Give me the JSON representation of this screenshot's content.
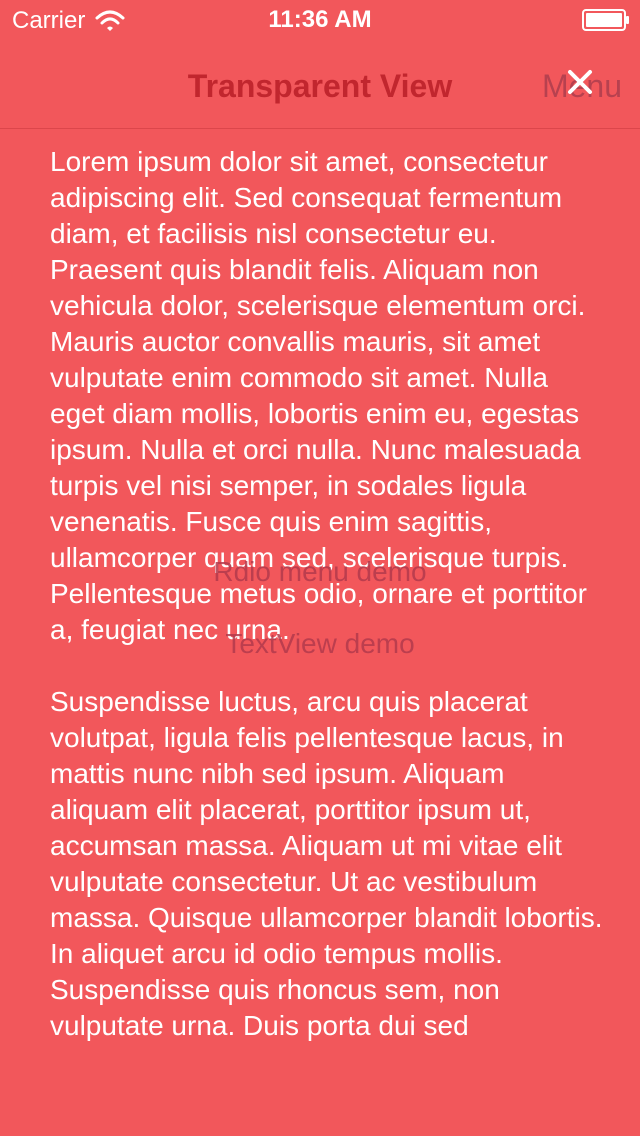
{
  "status_bar": {
    "carrier": "Carrier",
    "time": "11:36 AM",
    "wifi_icon": "wifi-icon",
    "battery_icon": "battery-icon"
  },
  "nav": {
    "title": "Transparent View",
    "menu_label": "Menu",
    "close_icon": "close-icon"
  },
  "content": {
    "paragraph_1": "Lorem ipsum dolor sit amet, consectetur adipiscing elit. Sed consequat fermentum diam, et facilisis nisl consectetur eu. Praesent quis blandit felis. Aliquam non vehicula dolor, scelerisque elementum orci. Mauris auctor convallis mauris, sit amet vulputate enim commodo sit amet. Nulla eget diam mollis, lobortis enim eu, egestas ipsum. Nulla et orci nulla. Nunc malesuada turpis vel nisi semper, in sodales ligula venenatis. Fusce quis enim sagittis, ullamcorper quam sed, scelerisque turpis. Pellentesque metus odio, ornare et porttitor a, feugiat nec urna.",
    "paragraph_2": "Suspendisse luctus, arcu quis placerat volutpat, ligula felis pellentesque lacus, in mattis nunc nibh sed ipsum. Aliquam aliquam elit placerat, porttitor ipsum ut, accumsan massa. Aliquam ut mi vitae elit vulputate consectetur. Ut ac vestibulum massa. Quisque ullamcorper blandit lobortis. In aliquet arcu id odio tempus mollis. Suspendisse quis rhoncus sem, non vulputate urna. Duis porta dui sed"
  },
  "menu": {
    "items": [
      {
        "label": "Rdio menu demo"
      },
      {
        "label": "TextView demo"
      }
    ]
  },
  "colors": {
    "background": "#f2575b",
    "title": "#c1262e",
    "text": "#ffffff",
    "menu_text": "#b33a4c"
  }
}
